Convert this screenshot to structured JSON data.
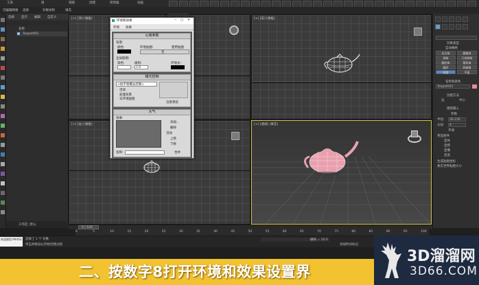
{
  "app": {
    "menus": [
      "工具",
      "组",
      "视图",
      "创建",
      "修改器",
      "动画"
    ],
    "top_tabs": [
      "可编辑网格",
      "选择",
      "对象绘制",
      "填充"
    ]
  },
  "scene_explorer": {
    "tabs": [
      "选择",
      "显示",
      "编辑",
      "自定义"
    ],
    "header": "名称",
    "items": [
      "Teapot001"
    ],
    "footer": "工作区: 默认"
  },
  "viewports": {
    "top": "[+] [顶] [线框]",
    "front": "[+] [前] [线框]",
    "left": "[+] [左] [线框]",
    "perspective": "[+] [透视] [真实]"
  },
  "dialog": {
    "title": "环境和效果",
    "tabs": [
      "环境",
      "效果"
    ],
    "common": {
      "header": "公用参数",
      "background": "背景:",
      "color": "颜色:",
      "env_map": "环境贴图:",
      "use_map": "使用贴图",
      "none": "无",
      "global_lighting": "全局照明:",
      "tint": "染色:",
      "level": "级别:",
      "level_value": "1.0",
      "ambient": "环境光:"
    },
    "exposure": {
      "header": "曝光控制",
      "dropdown": "<找不到曝光控制>",
      "active": "活动",
      "process_bg": "处理背景",
      "and_env": "与环境贴图",
      "render_preview": "渲染预览"
    },
    "atmosphere": {
      "header": "大气",
      "effects": "效果:",
      "add": "添加...",
      "delete": "删除",
      "active": "活动",
      "up": "上移",
      "down": "下移",
      "name": "名称:",
      "merge": "合并"
    }
  },
  "command_panel": {
    "object_type": "对象类型",
    "autogrid": "自动栅格",
    "objects": [
      "长方体",
      "圆锥体",
      "球体",
      "几何球体",
      "圆柱体",
      "管状体",
      "圆环",
      "四棱锥",
      "茶壶",
      "平面"
    ],
    "name_color": "名称和颜色",
    "object_name": "Teapot001",
    "creation_method": "创建方法",
    "edge": "边",
    "center": "中心",
    "keyboard_entry": "键盘输入",
    "params": "参数",
    "radius_label": "半径:",
    "radius": "36.236",
    "segments_label": "分段:",
    "segments": "4",
    "smooth": "平滑",
    "teapot_parts": "茶壶部件",
    "parts": [
      "壶体",
      "壶把",
      "壶嘴",
      "壶盖"
    ],
    "gen_map": "生成贴图坐标",
    "real_world": "真实世界贴图大小"
  },
  "timeline": {
    "frame": "0 / 100",
    "ticks": [
      "0",
      "5",
      "10",
      "15",
      "20",
      "25",
      "30",
      "35",
      "40",
      "45",
      "50",
      "55",
      "60",
      "65",
      "70",
      "75",
      "80",
      "85",
      "90",
      "95",
      "100"
    ]
  },
  "status": {
    "maxscript": "欢迎使用 MAXSc",
    "selected": "选择了 1 个 对象",
    "hint": "单击并拖动以开始创建过程",
    "grid": "栅格 = 10.0",
    "add_time_tag": "添加时间标记"
  },
  "caption": {
    "text": "二、按数字8打开环境和效果设置界",
    "bar_color": "#f2c230"
  },
  "watermark": {
    "cn": "3D溜溜网",
    "en": "3D66.COM"
  }
}
